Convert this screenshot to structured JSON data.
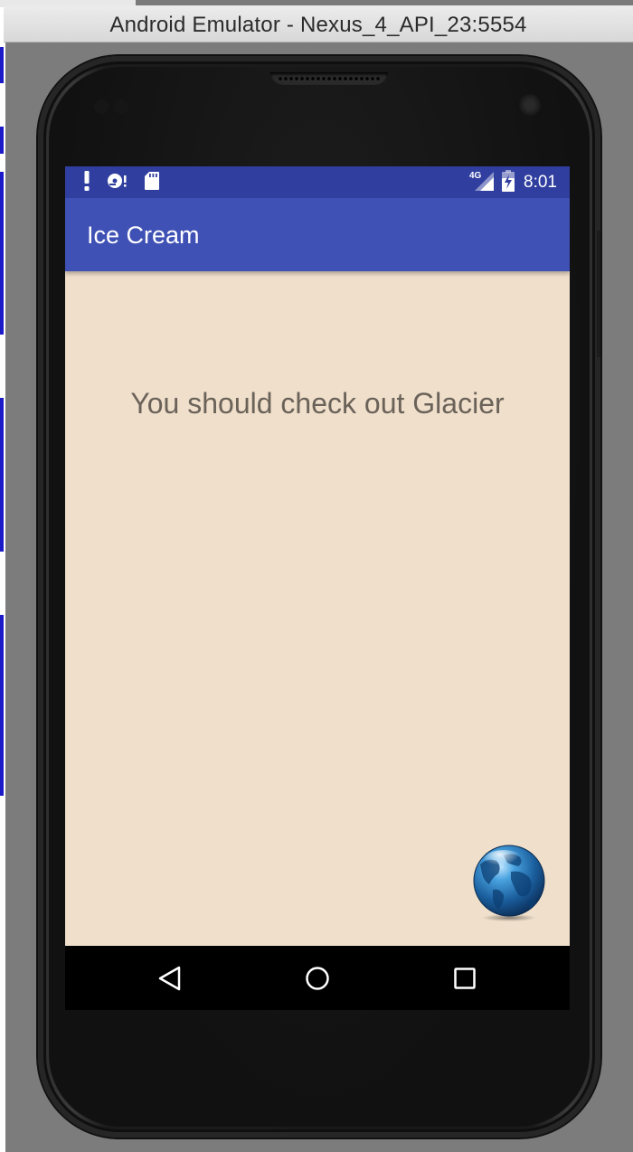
{
  "window": {
    "title": "Android Emulator - Nexus_4_API_23:5554"
  },
  "status_bar": {
    "left_icons": [
      "alert-icon",
      "disk-icon",
      "sd-card-icon"
    ],
    "network_label": "4G",
    "right_icons": [
      "cellular-signal-icon",
      "battery-charging-icon"
    ],
    "time": "8:01",
    "color": "#303f9f"
  },
  "app_bar": {
    "title": "Ice Cream",
    "color": "#3f51b5"
  },
  "content": {
    "message": "You should check out Glacier",
    "background": "#efdfcb"
  },
  "fab": {
    "icon": "globe-icon"
  },
  "nav_bar": {
    "buttons": [
      "back-icon",
      "home-icon",
      "recents-icon"
    ]
  }
}
